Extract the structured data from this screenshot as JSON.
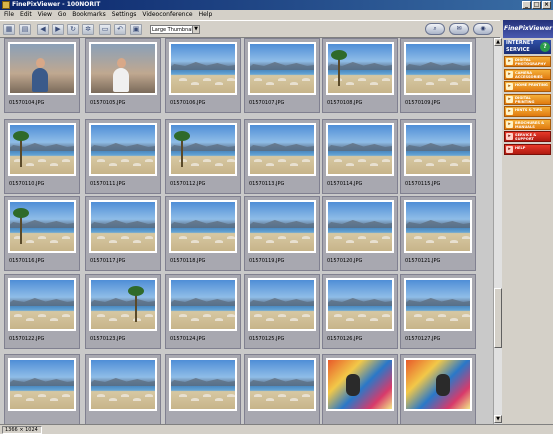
{
  "window": {
    "title": "FinePixViewer - 100NORIT"
  },
  "menu": [
    "File",
    "Edit",
    "View",
    "Go",
    "Bookmarks",
    "Settings",
    "Videoconference",
    "Help"
  ],
  "toolbar": {
    "size_select_value": "Large Thumbnail"
  },
  "brand": "FinePixViewer",
  "service": {
    "title_line1": "INTERNET",
    "title_line2": "SERVICE",
    "items": [
      {
        "label": "DIGITAL PHOTOGRAPHY",
        "style": "orange"
      },
      {
        "label": "CAMERA ACCESSORIES",
        "style": "orange"
      },
      {
        "label": "HOME PRINTING",
        "style": "orange"
      },
      {
        "label": "DIGITAL PRINTING",
        "style": "orange"
      },
      {
        "label": "HINTS & TIPS",
        "style": "orange"
      },
      {
        "label": "BROCHURES & MANUALS",
        "style": "orange"
      },
      {
        "label": "SERVICE & SUPPORT",
        "style": "red"
      },
      {
        "label": "HELP",
        "style": "red"
      }
    ]
  },
  "thumbnails": [
    {
      "file": "01570104.JPG",
      "kind": "people"
    },
    {
      "file": "01570105.JPG",
      "kind": "people"
    },
    {
      "file": "01570106.JPG",
      "kind": "beach"
    },
    {
      "file": "01570107.JPG",
      "kind": "beach"
    },
    {
      "file": "01570108.JPG",
      "kind": "palm"
    },
    {
      "file": "01570109.JPG",
      "kind": "beach"
    },
    {
      "file": "01570110.JPG",
      "kind": "palm"
    },
    {
      "file": "01570111.JPG",
      "kind": "beach"
    },
    {
      "file": "01570112.JPG",
      "kind": "palm"
    },
    {
      "file": "01570113.JPG",
      "kind": "beach"
    },
    {
      "file": "01570114.JPG",
      "kind": "beach"
    },
    {
      "file": "01570115.JPG",
      "kind": "beach"
    },
    {
      "file": "01570116.JPG",
      "kind": "palm"
    },
    {
      "file": "01570117.JPG",
      "kind": "beach"
    },
    {
      "file": "01570118.JPG",
      "kind": "beach"
    },
    {
      "file": "01570119.JPG",
      "kind": "beach"
    },
    {
      "file": "01570120.JPG",
      "kind": "beach"
    },
    {
      "file": "01570121.JPG",
      "kind": "beach"
    },
    {
      "file": "01570122.JPG",
      "kind": "beach"
    },
    {
      "file": "01570123.JPG",
      "kind": "palm"
    },
    {
      "file": "01570124.JPG",
      "kind": "beach"
    },
    {
      "file": "01570125.JPG",
      "kind": "beach"
    },
    {
      "file": "01570126.JPG",
      "kind": "beach"
    },
    {
      "file": "01570127.JPG",
      "kind": "beach"
    },
    {
      "file": "",
      "kind": "beach"
    },
    {
      "file": "",
      "kind": "beach"
    },
    {
      "file": "",
      "kind": "beach"
    },
    {
      "file": "",
      "kind": "beach"
    },
    {
      "file": "",
      "kind": "colorful"
    },
    {
      "file": "",
      "kind": "colorful"
    }
  ],
  "status": {
    "resolution": "1366 × 1024"
  }
}
